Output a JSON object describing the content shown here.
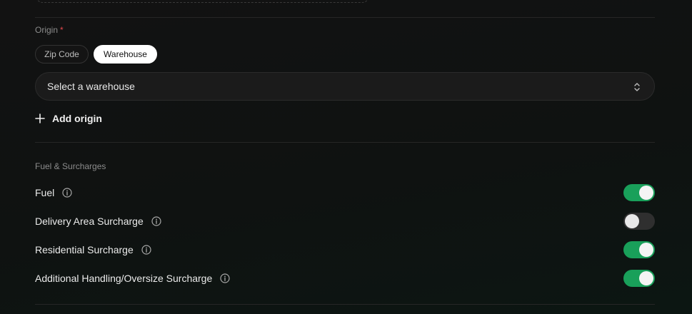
{
  "origin": {
    "label": "Origin",
    "required_marker": "*",
    "tabs": [
      {
        "label": "Zip Code",
        "selected": false
      },
      {
        "label": "Warehouse",
        "selected": true
      }
    ],
    "select": {
      "value": "Select a warehouse",
      "icon": "chevron-up-down-icon"
    },
    "add_origin": {
      "label": "Add origin",
      "icon": "plus-icon"
    }
  },
  "fuel_surcharges": {
    "label": "Fuel & Surcharges",
    "items": [
      {
        "label": "Fuel",
        "enabled": true,
        "icon": "info-icon"
      },
      {
        "label": "Delivery Area Surcharge",
        "enabled": false,
        "icon": "info-icon"
      },
      {
        "label": "Residential Surcharge",
        "enabled": true,
        "icon": "info-icon"
      },
      {
        "label": "Additional Handling/Oversize Surcharge",
        "enabled": true,
        "icon": "info-icon"
      }
    ]
  },
  "colors": {
    "toggle_on": "#19a05a",
    "toggle_off": "#2f2f2f",
    "required": "#e5484d"
  }
}
